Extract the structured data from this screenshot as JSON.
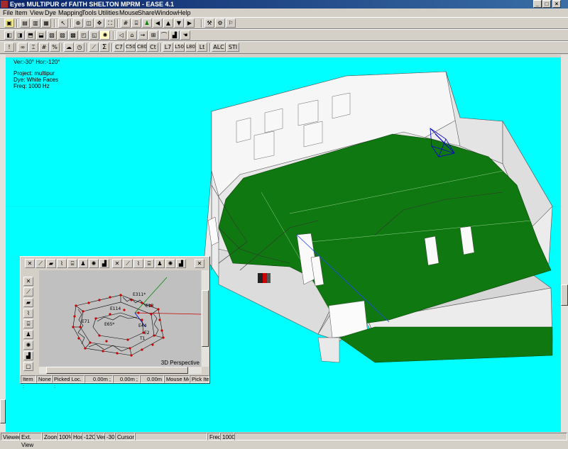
{
  "window": {
    "title": "Eyes MULTIPUR of FAITH SHELTON MPRM - EASE 4.1"
  },
  "menu": [
    "File",
    "Item",
    "View",
    "Dye",
    "Mapping",
    "Tools",
    "Utilities",
    "Mouse",
    "Share",
    "Window",
    "Help"
  ],
  "toolbar2_text": [
    "Σ",
    "C7",
    "C50",
    "C80",
    "Ct",
    "L7",
    "L50",
    "L80",
    "Lt",
    "ALC",
    "STI"
  ],
  "view_info": {
    "orientation": "Ver:-30°   Hor:-120°",
    "project": "Project: multipur",
    "dye": "Dye: White Faces",
    "freq": "Freq: 1000 Hz"
  },
  "subview": {
    "label": "3D Perspective",
    "point_labels": [
      "E311*",
      "E114",
      "E13",
      "E71",
      "E65*",
      "E44",
      "T1",
      "E2"
    ],
    "status": {
      "item_label": "Item :",
      "item_value": "None",
      "picked_label": "Picked Loc. :",
      "x": "0.00m ;",
      "y": "0.00m ;",
      "z": "0.00m",
      "mode_label": "Mouse Mode :",
      "mode_value": "Pick Item"
    }
  },
  "statusbar": {
    "viewer": "Viewer",
    "ext_view": "Ext. View",
    "zoom_label": "Zoom",
    "zoom_value": "100%",
    "hor_label": "Hor",
    "hor_value": "-120",
    "ver_label": "Ver",
    "ver_value": "-30",
    "cursor": "Cursor",
    "freq_label": "Freq",
    "freq_value": "1000"
  },
  "colors": {
    "background": "#00ffff",
    "floor": "#107810",
    "walls": "#f0f0f0"
  }
}
